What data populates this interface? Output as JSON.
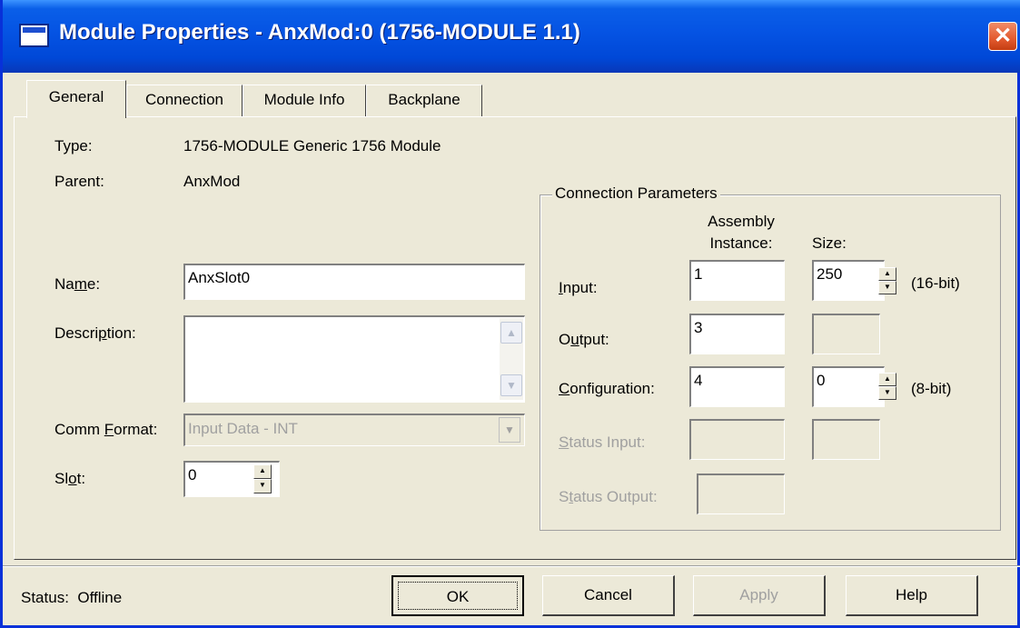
{
  "window": {
    "title": "Module Properties  - AnxMod:0 (1756-MODULE 1.1)",
    "close_glyph": "✕"
  },
  "tabs": [
    {
      "label": "General",
      "active": true
    },
    {
      "label": "Connection",
      "active": false
    },
    {
      "label": "Module Info",
      "active": false
    },
    {
      "label": "Backplane",
      "active": false
    }
  ],
  "general": {
    "type_label": "Type:",
    "type_value": "1756-MODULE Generic 1756 Module",
    "parent_label": "Parent:",
    "parent_value": "AnxMod",
    "name_label_pre": "Na",
    "name_label_u": "m",
    "name_label_post": "e:",
    "name_value": "AnxSlot0",
    "description_label_pre": "Descri",
    "description_label_u": "p",
    "description_label_post": "tion:",
    "description_value": "",
    "comm_format_label_pre": "Comm ",
    "comm_format_label_u": "F",
    "comm_format_label_post": "ormat:",
    "comm_format_value": "Input Data - INT",
    "slot_label_pre": "Sl",
    "slot_label_u": "o",
    "slot_label_post": "t:",
    "slot_value": "0"
  },
  "connection_parameters": {
    "title": "Connection Parameters",
    "assembly_header_line1": "Assembly",
    "assembly_header_line2": "Instance:",
    "size_header": "Size:",
    "input_label_u": "I",
    "input_label_post": "nput:",
    "input_instance": "1",
    "input_size": "250",
    "input_size_unit": "(16-bit)",
    "output_label_pre": "O",
    "output_label_u": "u",
    "output_label_post": "tput:",
    "output_instance": "3",
    "configuration_label_u": "C",
    "configuration_label_post": "onfiguration:",
    "configuration_instance": "4",
    "configuration_size": "0",
    "configuration_size_unit": "(8-bit)",
    "status_input_label_u": "S",
    "status_input_label_post": "tatus Input:",
    "status_output_label_pre": "S",
    "status_output_label_u": "t",
    "status_output_label_post": "atus Output:"
  },
  "footer": {
    "status_label": "Status:",
    "status_value": "Offline",
    "ok_label": "OK",
    "cancel_label": "Cancel",
    "apply_label": "Apply",
    "help_label": "Help"
  }
}
